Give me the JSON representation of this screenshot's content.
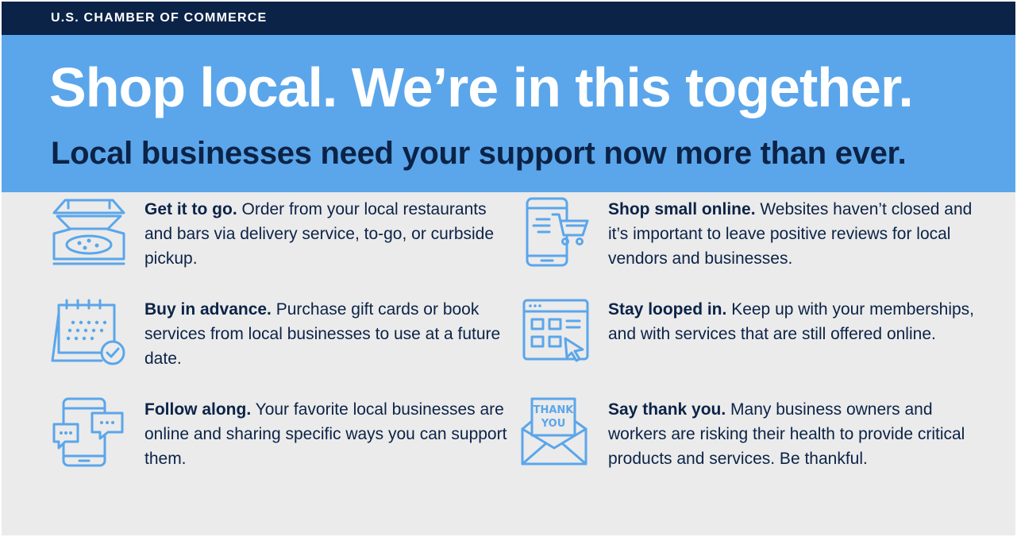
{
  "header": {
    "org": "U.S. CHAMBER OF COMMERCE"
  },
  "hero": {
    "headline": "Shop local. We’re in this together.",
    "subhead": "Local businesses need your support now more than ever."
  },
  "tips": [
    {
      "icon": "pizza-box-icon",
      "title": "Get it to go.",
      "body": " Order from your local restaurants and bars via delivery service, to-go, or curbside pickup."
    },
    {
      "icon": "calendar-check-icon",
      "title": "Buy in advance.",
      "body": " Purchase gift cards or book services from local businesses to use at a future date."
    },
    {
      "icon": "phone-chat-icon",
      "title": "Follow along.",
      "body": " Your favorite local businesses are online and sharing specific ways you can support them."
    },
    {
      "icon": "phone-cart-icon",
      "title": "Shop small online.",
      "body": " Websites haven’t closed and it’s important to leave positive reviews for local vendors and businesses."
    },
    {
      "icon": "browser-click-icon",
      "title": "Stay looped in.",
      "body": " Keep up with your memberships, and with services that are still offered online."
    },
    {
      "icon": "thank-you-envelope-icon",
      "title": "Say thank you.",
      "body": " Many business owners and workers are risking their health to provide critical products and services. Be thankful.",
      "icon_text_line1": "THANK",
      "icon_text_line2": "YOU"
    }
  ],
  "colors": {
    "navy": "#0b2347",
    "blue": "#5ba6ea",
    "background": "#ebebeb"
  }
}
